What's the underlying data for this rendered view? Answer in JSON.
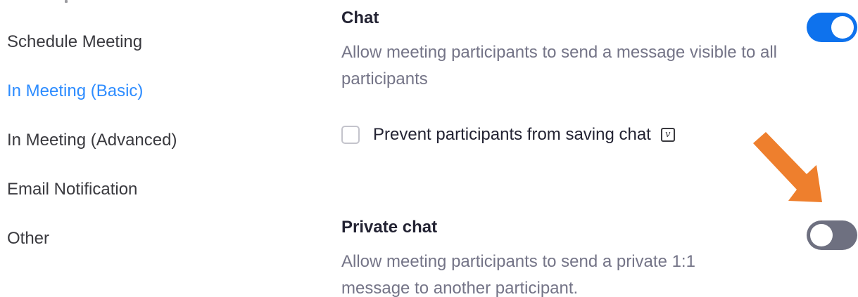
{
  "sidebar": {
    "items": [
      {
        "label": "Schedule Meeting",
        "active": false
      },
      {
        "label": "In Meeting (Basic)",
        "active": true
      },
      {
        "label": "In Meeting (Advanced)",
        "active": false
      },
      {
        "label": "Email Notification",
        "active": false
      },
      {
        "label": "Other",
        "active": false
      }
    ]
  },
  "settings": {
    "chat": {
      "title": "Chat",
      "description": "Allow meeting participants to send a message visible to all participants",
      "enabled": true,
      "prevent_saving": {
        "label": "Prevent participants from saving chat",
        "checked": false,
        "icon": "version-icon",
        "icon_glyph": "v"
      }
    },
    "private_chat": {
      "title": "Private chat",
      "description": "Allow meeting participants to send a private 1:1 message to another participant.",
      "enabled": false
    }
  },
  "colors": {
    "accent": "#2d8cff",
    "toggle_on": "#0e72ed",
    "toggle_off": "#6e7080",
    "arrow": "#ee7f2d"
  }
}
